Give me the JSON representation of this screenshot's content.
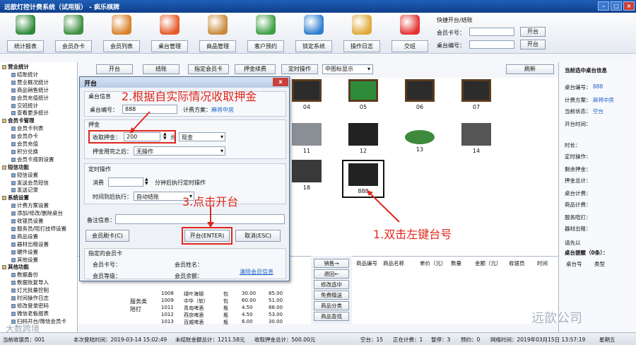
{
  "window": {
    "title": "远歆灯控计费系统（试用版） - 疯乐棋牌"
  },
  "toolbar": {
    "items": [
      {
        "label": "统计报表",
        "icon": "bar-chart-icon",
        "color": "#2e8b3a"
      },
      {
        "label": "会员办卡",
        "icon": "add-user-icon",
        "color": "#3f8f3f"
      },
      {
        "label": "会员列表",
        "icon": "users-icon",
        "color": "#d9822b"
      },
      {
        "label": "桌台管理",
        "icon": "refresh-icon",
        "color": "#e55a28"
      },
      {
        "label": "商品管理",
        "icon": "tag-icon",
        "color": "#c98a3b"
      },
      {
        "label": "客户预约",
        "icon": "alarm-clock-icon",
        "color": "#3fa044"
      },
      {
        "label": "锁定系统",
        "icon": "lock-icon",
        "color": "#2f7fd1"
      },
      {
        "label": "操作日志",
        "icon": "clipboard-icon",
        "color": "#e0a93a"
      },
      {
        "label": "交班",
        "icon": "spinner-icon",
        "color": "#e53232"
      }
    ]
  },
  "quick": {
    "title": "快捷开台/结账",
    "card_label": "会员卡号：",
    "table_label": "桌台编号：",
    "open_btn": "开台",
    "settle_btn": "开台"
  },
  "tree": {
    "items": [
      {
        "label": "营业统计",
        "lv": 0
      },
      {
        "label": "结账统计",
        "lv": 1
      },
      {
        "label": "营业概况统计",
        "lv": 1
      },
      {
        "label": "商品销售统计",
        "lv": 1
      },
      {
        "label": "会员充值统计",
        "lv": 1
      },
      {
        "label": "交班统计",
        "lv": 1
      },
      {
        "label": "查看更多统计",
        "lv": 1
      },
      {
        "label": "会员卡管理",
        "lv": 0
      },
      {
        "label": "会员卡列表",
        "lv": 1
      },
      {
        "label": "会员办卡",
        "lv": 1
      },
      {
        "label": "会员充值",
        "lv": 1
      },
      {
        "label": "积分兑换",
        "lv": 1
      },
      {
        "label": "会员卡规则设置",
        "lv": 1
      },
      {
        "label": "短信功能",
        "lv": 0
      },
      {
        "label": "短信设置",
        "lv": 1
      },
      {
        "label": "发送会员短信",
        "lv": 1
      },
      {
        "label": "发送记录",
        "lv": 1
      },
      {
        "label": "系统设置",
        "lv": 0
      },
      {
        "label": "计费方案设置",
        "lv": 1
      },
      {
        "label": "添加/修改/删除桌台",
        "lv": 1
      },
      {
        "label": "收银员设置",
        "lv": 1
      },
      {
        "label": "服务员/陪打技师设置",
        "lv": 1
      },
      {
        "label": "商品设置",
        "lv": 1
      },
      {
        "label": "器材出租设置",
        "lv": 1
      },
      {
        "label": "硬件设置",
        "lv": 1
      },
      {
        "label": "其他设置",
        "lv": 1
      },
      {
        "label": "其他功能",
        "lv": 0
      },
      {
        "label": "数据备份",
        "lv": 1
      },
      {
        "label": "数据恢复导入",
        "lv": 1
      },
      {
        "label": "灯光批量控制",
        "lv": 1
      },
      {
        "label": "时间操作日志",
        "lv": 1
      },
      {
        "label": "修改登录密码",
        "lv": 1
      },
      {
        "label": "微信老板报表",
        "lv": 1
      },
      {
        "label": "扫码开台/微信会员卡",
        "lv": 1
      }
    ]
  },
  "topbar": {
    "buttons": [
      "开台",
      "结账",
      "指定会员卡",
      "押金续费",
      "定时操作"
    ],
    "display_mode": "中图标显示",
    "refresh": "刷新"
  },
  "tables": [
    {
      "num": "04",
      "kind": "snooker"
    },
    {
      "num": "05",
      "kind": "pool-green"
    },
    {
      "num": "06",
      "kind": "snooker"
    },
    {
      "num": "07",
      "kind": "snooker"
    },
    {
      "num": "11",
      "kind": "mahjong-gray"
    },
    {
      "num": "12",
      "kind": "mahjong"
    },
    {
      "num": "13",
      "kind": "round-table"
    },
    {
      "num": "14",
      "kind": "pingpong"
    },
    {
      "num": "18",
      "kind": "teapot"
    },
    {
      "num": "888",
      "kind": "mahjong"
    }
  ],
  "right_panel": {
    "title": "当前选中桌台信息",
    "fields": [
      {
        "label": "桌台编号：",
        "value": "888"
      },
      {
        "label": "计费方案：",
        "value": "麻将中房"
      },
      {
        "label": "当前状态：",
        "value": "空台"
      },
      {
        "label": "开台时间：",
        "value": ""
      },
      {
        "label": "时长：",
        "value": ""
      },
      {
        "label": "定时操作：",
        "value": ""
      },
      {
        "label": "剩余押金：",
        "value": ""
      },
      {
        "label": "押金总计：",
        "value": ""
      },
      {
        "label": "桌台计费：",
        "value": ""
      },
      {
        "label": "商品计费：",
        "value": ""
      },
      {
        "label": "服务陪打：",
        "value": ""
      },
      {
        "label": "器材出租：",
        "value": ""
      },
      {
        "label": "请先以",
        "value": ""
      }
    ],
    "reminder": "桌台提醒（0条）：",
    "reminder_cols": [
      "桌台号",
      "类型"
    ]
  },
  "dialog": {
    "title": "开台",
    "close": "x",
    "group_table": "桌台信息",
    "table_no_label": "桌台编号：",
    "table_no": "888",
    "plan_label": "计费方案：",
    "plan": "麻将中房",
    "group_deposit": "押金",
    "deposit_label": "收取押金：",
    "deposit_value": "200",
    "yuan": "元",
    "pay_method": "现金",
    "after_label": "押金用完之后：",
    "after_value": "无操作",
    "group_timer": "定时操作",
    "consume_label": "消费",
    "minutes_label": "分钟后执行定时操作",
    "exec_label": "时间到后执行：",
    "exec_value": "自动结账",
    "memo_label": "备注信息：",
    "memo_value": "",
    "swipe_btn": "会员刷卡(C)",
    "open_btn": "开台(ENTER)",
    "cancel_btn": "取消(ESC)",
    "group_member": "指定的会员卡",
    "member_card_label": "会员卡号：",
    "member_name_label": "会员姓名：",
    "clear_member": "清除会员信息",
    "member_level_label": "会员等级：",
    "member_balance_label": "会员余额："
  },
  "annotations": {
    "a1": "1.双击左键台号",
    "a2": "2.根据自实际情况收取押金",
    "a3": "3.点击开台"
  },
  "goods": {
    "categories": [
      "服务类",
      "陪打"
    ],
    "rows": [
      {
        "code": "1008",
        "name": "绿叶海钢",
        "unit": "包",
        "price": "30.00",
        "stock": "85.00"
      },
      {
        "code": "1009",
        "name": "中华（软）",
        "unit": "包",
        "price": "60.00",
        "stock": "51.00"
      },
      {
        "code": "1011",
        "name": "青岛啤酒",
        "unit": "瓶",
        "price": "4.50",
        "stock": "88.00"
      },
      {
        "code": "1012",
        "name": "燕京啤酒",
        "unit": "瓶",
        "price": "4.50",
        "stock": "53.00"
      },
      {
        "code": "1013",
        "name": "百威啤酒",
        "unit": "瓶",
        "price": "6.00",
        "stock": "30.00"
      }
    ],
    "side_buttons": [
      "销售→",
      "退回←",
      "修改选中",
      "免费赠送",
      "商品分类",
      "商品查找"
    ],
    "cols": [
      "商品编号",
      "商品名称",
      "单价（元）",
      "数量",
      "金额（元）",
      "收银员",
      "时间"
    ]
  },
  "status": {
    "cashier": "当前收银员：001",
    "login": "本次登陆时间：2019-03-14 15:02:49",
    "unsettled": "未结账金额总计：1211.58元",
    "deposit_total": "收取押金总计：500.00元",
    "empty": "空台：15",
    "billing": "正在计费：1",
    "paused": "暂停：3",
    "reserved": "预约：0",
    "time": "网络时间：2019年03月15日 13:57:19",
    "weekday": "星期五"
  },
  "watermark": {
    "left": "大数跨境",
    "right": "远歆公司"
  }
}
